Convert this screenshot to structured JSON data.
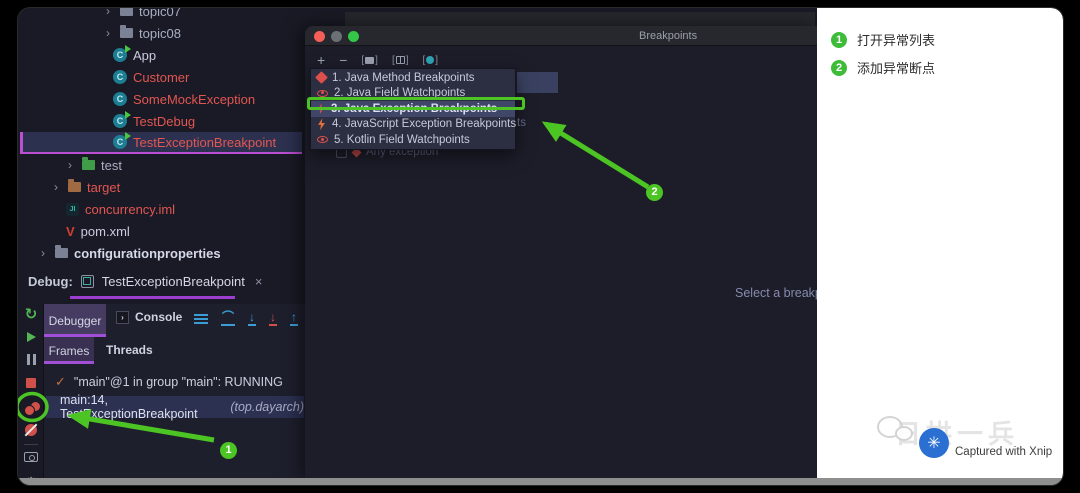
{
  "project_tree": {
    "items": [
      {
        "label": "topic07",
        "type": "folder"
      },
      {
        "label": "topic08",
        "type": "folder"
      },
      {
        "label": "App",
        "type": "class-runnable"
      },
      {
        "label": "Customer",
        "type": "class"
      },
      {
        "label": "SomeMockException",
        "type": "class"
      },
      {
        "label": "TestDebug",
        "type": "class-runnable"
      },
      {
        "label": "TestExceptionBreakpoint",
        "type": "class-runnable",
        "selected": true
      },
      {
        "label": "test",
        "type": "test-folder"
      },
      {
        "label": "target",
        "type": "excluded-folder"
      },
      {
        "label": "concurrency.iml",
        "type": "iml-file"
      },
      {
        "label": "pom.xml",
        "type": "maven-file"
      },
      {
        "label": "configurationproperties",
        "type": "project-root"
      }
    ]
  },
  "breakpoints_dialog": {
    "title": "Breakpoints",
    "toolbar": {
      "add_label": "+",
      "remove_label": "−"
    },
    "menu": {
      "items": [
        {
          "label": "1. Java Method Breakpoints"
        },
        {
          "label": "2. Java Field Watchpoints"
        },
        {
          "label": "3. Java Exception Breakpoints",
          "selected": true
        },
        {
          "label": "4. JavaScript Exception Breakpoints"
        },
        {
          "label": "5. Kotlin Field Watchpoints"
        }
      ]
    },
    "background": {
      "clipped_text": "ts",
      "any_exception_label": "Any exception",
      "select_hint_text": "Select a breakp"
    }
  },
  "debug_panel": {
    "debug_label": "Debug:",
    "session_tab_label": "TestExceptionBreakpoint",
    "session_tab_close": "×",
    "debugger_tab": "Debugger",
    "console_tab": "Console",
    "frames_tab": "Frames",
    "threads_tab": "Threads",
    "thread_status": "\"main\"@1 in group \"main\": RUNNING",
    "frame_location": "main:14, TestExceptionBreakpoint",
    "frame_package": "(top.dayarch)"
  },
  "annotations": {
    "color": "#4cc424",
    "badge1": "1",
    "badge2": "2",
    "notes": [
      {
        "num": "1",
        "text": "打开异常列表"
      },
      {
        "num": "2",
        "text": "添加异常断点"
      }
    ]
  },
  "watermark": {
    "brand_text": "日拱一兵",
    "captured_text": "Captured with Xnip"
  }
}
